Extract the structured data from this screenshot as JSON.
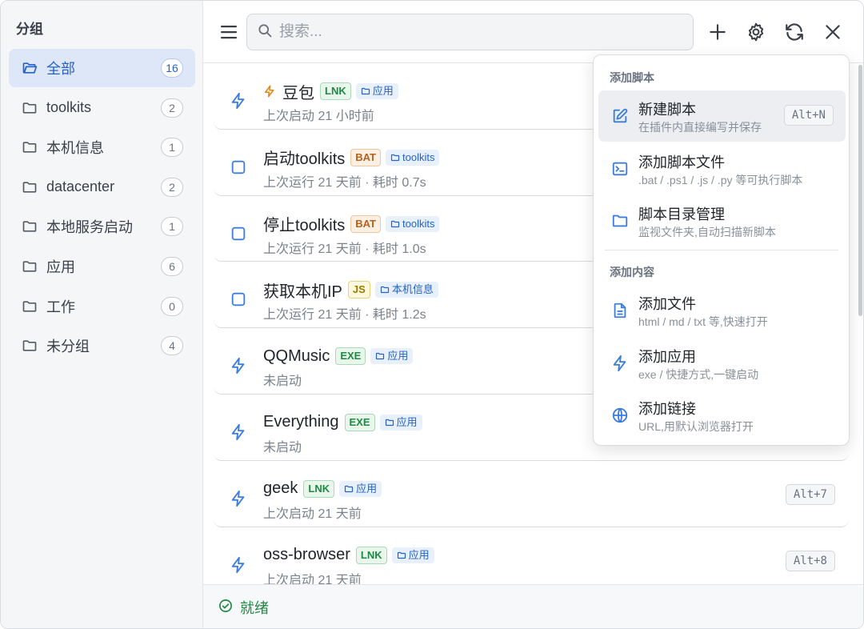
{
  "sidebar": {
    "title": "分组",
    "groups": [
      {
        "label": "全部",
        "count": "16"
      },
      {
        "label": "toolkits",
        "count": "2"
      },
      {
        "label": "本机信息",
        "count": "1"
      },
      {
        "label": "datacenter",
        "count": "2"
      },
      {
        "label": "本地服务启动",
        "count": "1"
      },
      {
        "label": "应用",
        "count": "6"
      },
      {
        "label": "工作",
        "count": "0"
      },
      {
        "label": "未分组",
        "count": "4"
      }
    ]
  },
  "toolbar": {
    "search_placeholder": "搜索...",
    "icons": [
      "menu-icon",
      "search-icon",
      "plus-icon",
      "gear-icon",
      "refresh-icon",
      "close-icon"
    ]
  },
  "items": [
    {
      "name": "豆包",
      "type": "LNK",
      "group": "应用",
      "sub": "上次启动 21 小时前",
      "icon": "flash-icon",
      "pinned": true,
      "hotkey": ""
    },
    {
      "name": "启动toolkits",
      "type": "BAT",
      "group": "toolkits",
      "sub": "上次运行 21 天前 · 耗时 0.7s",
      "icon": "checkbox-icon",
      "hotkey": ""
    },
    {
      "name": "停止toolkits",
      "type": "BAT",
      "group": "toolkits",
      "sub": "上次运行 21 天前 · 耗时 1.0s",
      "icon": "checkbox-icon",
      "hotkey": ""
    },
    {
      "name": "获取本机IP",
      "type": "JS",
      "group": "本机信息",
      "sub": "上次运行 21 天前 · 耗时 1.2s",
      "icon": "checkbox-icon",
      "hotkey": ""
    },
    {
      "name": "QQMusic",
      "type": "EXE",
      "group": "应用",
      "sub": "未启动",
      "icon": "flash-icon",
      "hotkey": ""
    },
    {
      "name": "Everything",
      "type": "EXE",
      "group": "应用",
      "sub": "未启动",
      "icon": "flash-icon",
      "hotkey": ""
    },
    {
      "name": "geek",
      "type": "LNK",
      "group": "应用",
      "sub": "上次启动 21 天前",
      "icon": "flash-icon",
      "hotkey": "Alt+7"
    },
    {
      "name": "oss-browser",
      "type": "LNK",
      "group": "应用",
      "sub": "上次启动 21 天前",
      "icon": "flash-icon",
      "hotkey": "Alt+8"
    }
  ],
  "status": {
    "text": "就绪",
    "color": "#1e8a43"
  },
  "dropdown": {
    "section_script": "添加脚本",
    "section_content": "添加内容",
    "script_items": [
      {
        "title": "新建脚本",
        "desc": "在插件内直接编写并保存",
        "hotkey": "Alt+N",
        "icon": "edit-icon"
      },
      {
        "title": "添加脚本文件",
        "desc": ".bat / .ps1 / .js / .py 等可执行脚本",
        "icon": "terminal-icon"
      },
      {
        "title": "脚本目录管理",
        "desc": "监视文件夹,自动扫描新脚本",
        "icon": "folder-icon"
      }
    ],
    "content_items": [
      {
        "title": "添加文件",
        "desc": "html / md / txt 等,快速打开",
        "icon": "file-icon"
      },
      {
        "title": "添加应用",
        "desc": "exe / 快捷方式,一键启动",
        "icon": "flash-icon"
      },
      {
        "title": "添加链接",
        "desc": "URL,用默认浏览器打开",
        "icon": "globe-icon"
      }
    ]
  },
  "colors": {
    "accent": "#2563c9",
    "active_bg": "#dde7f7",
    "success": "#1e8a43"
  }
}
